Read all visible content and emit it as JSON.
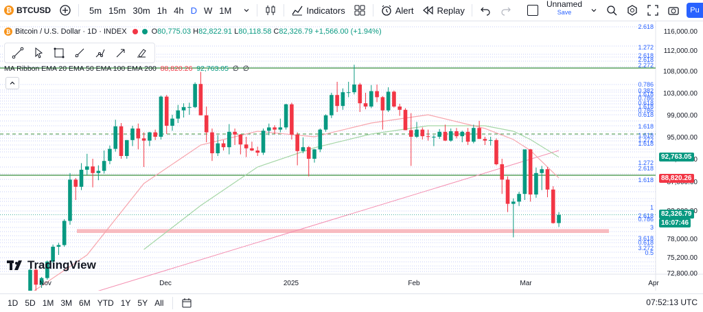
{
  "toolbar": {
    "symbol": "BTCUSD",
    "symbol_initial": "₿",
    "timeframes": [
      "5m",
      "15m",
      "30m",
      "1h",
      "4h",
      "D",
      "W",
      "1M"
    ],
    "active_timeframe": "D",
    "indicators_label": "Indicators",
    "alert_label": "Alert",
    "replay_label": "Replay",
    "layout_name": "Unnamed",
    "layout_status": "Save",
    "publish_label": "Pu"
  },
  "legend": {
    "title": "Bitcoin / U.S. Dollar · 1D · INDEX",
    "open_label": "O",
    "open": "80,775.03",
    "high_label": "H",
    "high": "82,822.91",
    "low_label": "L",
    "low": "80,118.58",
    "close_label": "C",
    "close": "82,326.79",
    "change": "+1,566.00 (+1.94%)"
  },
  "indicator": {
    "name": "MA Ribbon EMA 20 EMA 50 EMA 100 EMA 200",
    "v1": "88,820.26",
    "v2": "92,763.05",
    "v3": "∅",
    "v4": "∅"
  },
  "price_axis": [
    "116,000.00",
    "112,000.00",
    "108,000.00",
    "103,000.00",
    "99,000.00",
    "95,000.00",
    "91,000.00",
    "87,000.00",
    "82,000.00",
    "78,000.00",
    "75,200.00",
    "72,800.00"
  ],
  "price_tags": {
    "ema50": "92,763.05",
    "ema20": "88,820.26",
    "last_price": "82,326.79",
    "countdown": "16:07:46"
  },
  "fib_labels": [
    "2.618",
    "1.272",
    "2.618",
    "2.618",
    "2.272",
    "0.786",
    "0.382",
    "1.618",
    "0.786",
    "0.618",
    "1.618",
    "0.786",
    "0.618",
    "1.618",
    "1.618",
    "1.272",
    "1.618",
    "1.272",
    "2.618",
    "1.618",
    "1",
    "2.618",
    "0.786",
    "3",
    "3.618",
    "0.618",
    "3.272",
    "0.5"
  ],
  "time_axis": [
    "Nov",
    "Dec",
    "2025",
    "Feb",
    "Mar",
    "Apr"
  ],
  "bottom": {
    "ranges": [
      "1D",
      "5D",
      "1M",
      "3M",
      "6M",
      "YTD",
      "1Y",
      "5Y",
      "All"
    ],
    "clock": "07:52:13 UTC"
  },
  "branding": "TradingView",
  "colors": {
    "up": "#089981",
    "down": "#f23645",
    "accent": "#2962ff",
    "ema20": "#f7a5ad",
    "ema50": "#a5d6a7",
    "zone": "#f8bbc0"
  },
  "chart_data": {
    "type": "candlestick",
    "ylim": [
      72000,
      118000
    ],
    "candles": [
      [
        68000,
        72500,
        67800,
        72300
      ],
      [
        72300,
        72600,
        68500,
        69600
      ],
      [
        69600,
        71000,
        69000,
        70800
      ],
      [
        70800,
        74000,
        70500,
        73800
      ],
      [
        73800,
        76900,
        73500,
        76500
      ],
      [
        76500,
        77200,
        75000,
        76800
      ],
      [
        76800,
        81500,
        76500,
        81200
      ],
      [
        81200,
        89900,
        80500,
        88700
      ],
      [
        88700,
        89000,
        85000,
        87400
      ],
      [
        87400,
        91700,
        86800,
        90500
      ],
      [
        90500,
        93400,
        89500,
        91100
      ],
      [
        91100,
        92500,
        87300,
        89900
      ],
      [
        89900,
        91300,
        88600,
        90300
      ],
      [
        90300,
        94000,
        89800,
        92100
      ],
      [
        92100,
        94900,
        91500,
        94300
      ],
      [
        94300,
        99600,
        93800,
        98400
      ],
      [
        98400,
        99000,
        92500,
        93000
      ],
      [
        93000,
        95900,
        92500,
        95900
      ],
      [
        95900,
        98500,
        94800,
        98000
      ],
      [
        98000,
        98900,
        94200,
        96200
      ],
      [
        96200,
        97300,
        91000,
        95800
      ],
      [
        95800,
        97400,
        94800,
        97300
      ],
      [
        97300,
        97800,
        95900,
        96500
      ],
      [
        96500,
        104000,
        96000,
        103800
      ],
      [
        103800,
        104100,
        97000,
        98500
      ],
      [
        98500,
        100500,
        97600,
        99800
      ],
      [
        99800,
        102300,
        99000,
        101300
      ],
      [
        101300,
        102600,
        100000,
        101900
      ],
      [
        101900,
        102700,
        100500,
        101900
      ],
      [
        101900,
        106400,
        101700,
        106100
      ],
      [
        106100,
        108300,
        100400,
        100400
      ],
      [
        100400,
        102000,
        95500,
        97300
      ],
      [
        97300,
        98000,
        92100,
        93500
      ],
      [
        93500,
        96800,
        93000,
        95300
      ],
      [
        95300,
        95900,
        94000,
        94600
      ],
      [
        94600,
        98800,
        93300,
        97400
      ],
      [
        97400,
        98000,
        95000,
        96900
      ],
      [
        96900,
        97000,
        93300,
        95100
      ],
      [
        95100,
        96500,
        92800,
        94400
      ],
      [
        94400,
        95600,
        93900,
        94000
      ],
      [
        94000,
        94700,
        93000,
        93600
      ],
      [
        93600,
        98000,
        93200,
        97600
      ],
      [
        97600,
        98900,
        96800,
        98200
      ],
      [
        98200,
        98600,
        97000,
        97800
      ],
      [
        97800,
        99800,
        97300,
        98200
      ],
      [
        98200,
        102500,
        97800,
        102400
      ],
      [
        102400,
        102700,
        96000,
        96900
      ],
      [
        96900,
        97300,
        91300,
        93900
      ],
      [
        93900,
        96400,
        93500,
        94600
      ],
      [
        94600,
        94800,
        89300,
        92500
      ],
      [
        92500,
        94300,
        91800,
        94200
      ],
      [
        94200,
        98000,
        93700,
        97800
      ],
      [
        97800,
        100600,
        97400,
        100400
      ],
      [
        100400,
        104500,
        99900,
        104100
      ],
      [
        104100,
        106500,
        101000,
        102100
      ],
      [
        102100,
        105300,
        101400,
        104600
      ],
      [
        104600,
        106500,
        103700,
        104600
      ],
      [
        104600,
        109600,
        104200,
        106000
      ],
      [
        106000,
        106300,
        101000,
        102600
      ],
      [
        102600,
        104500,
        101500,
        102000
      ],
      [
        102000,
        105900,
        101700,
        104800
      ],
      [
        104800,
        106000,
        102800,
        103700
      ],
      [
        103700,
        103900,
        97800,
        101300
      ],
      [
        101300,
        105500,
        101000,
        104700
      ],
      [
        104700,
        104900,
        101800,
        102000
      ],
      [
        102000,
        102500,
        100300,
        101400
      ],
      [
        101400,
        101700,
        97700,
        97700
      ],
      [
        97700,
        100800,
        91200,
        96500
      ],
      [
        96500,
        99200,
        96300,
        97800
      ],
      [
        97800,
        98200,
        96000,
        96600
      ],
      [
        96600,
        97800,
        95800,
        96500
      ],
      [
        96500,
        96800,
        94800,
        96500
      ],
      [
        96500,
        97900,
        96100,
        97400
      ],
      [
        97400,
        98700,
        95700,
        95800
      ],
      [
        95800,
        98000,
        95600,
        97500
      ],
      [
        97500,
        98100,
        96200,
        96600
      ],
      [
        96600,
        97600,
        95500,
        97400
      ],
      [
        97400,
        98100,
        95000,
        95600
      ],
      [
        95600,
        98700,
        95300,
        98100
      ],
      [
        98100,
        99400,
        96400,
        96100
      ],
      [
        96100,
        96500,
        95000,
        95800
      ],
      [
        95800,
        96500,
        94900,
        95900
      ],
      [
        95900,
        96200,
        91300,
        91500
      ],
      [
        91500,
        92500,
        86100,
        88700
      ],
      [
        88700,
        89300,
        82800,
        84300
      ],
      [
        84300,
        85300,
        78200,
        84700
      ],
      [
        84700,
        86500,
        83900,
        86100
      ],
      [
        86100,
        94100,
        85000,
        94200
      ],
      [
        94200,
        94300,
        84700,
        86000
      ],
      [
        86000,
        90900,
        85400,
        89900
      ],
      [
        89900,
        91200,
        86800,
        90600
      ],
      [
        90600,
        91000,
        85500,
        86900
      ],
      [
        86900,
        87500,
        80700,
        80800
      ],
      [
        80800,
        82800,
        80100,
        82300
      ]
    ],
    "ema20": [
      [
        0,
        68000
      ],
      [
        10,
        75000
      ],
      [
        20,
        88000
      ],
      [
        30,
        95000
      ],
      [
        40,
        97500
      ],
      [
        50,
        96500
      ],
      [
        60,
        99000
      ],
      [
        70,
        100500
      ],
      [
        80,
        98000
      ],
      [
        85,
        96000
      ],
      [
        88,
        94000
      ],
      [
        93,
        89000
      ]
    ],
    "ema50": [
      [
        20,
        76000
      ],
      [
        30,
        84000
      ],
      [
        40,
        91000
      ],
      [
        50,
        94500
      ],
      [
        60,
        97000
      ],
      [
        70,
        98500
      ],
      [
        80,
        98500
      ],
      [
        85,
        97500
      ],
      [
        88,
        96000
      ],
      [
        93,
        92800
      ]
    ],
    "ema200": [
      [
        0,
        63000
      ],
      [
        93,
        94000
      ]
    ],
    "support_zone": [
      79000,
      79700
    ],
    "horizontal_levels": [
      109000,
      89500,
      97000
    ]
  }
}
